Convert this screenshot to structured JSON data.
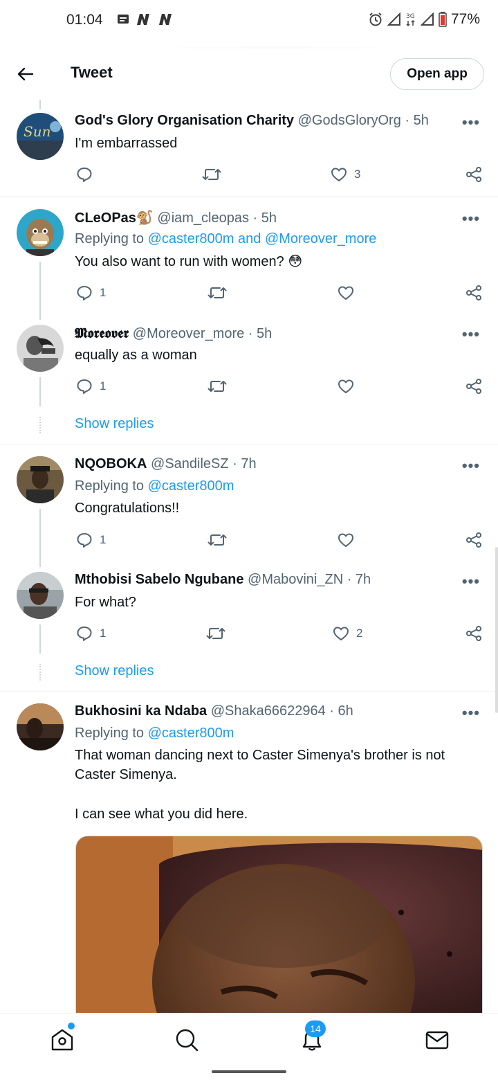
{
  "status_bar": {
    "time": "01:04",
    "left_icons": [
      "message-icon",
      "n-icon",
      "n-icon"
    ],
    "right_icons": [
      "alarm-icon",
      "signal-icon",
      "3g-icon",
      "signal-icon",
      "battery-icon"
    ],
    "network": "3G",
    "battery": "77%"
  },
  "header": {
    "title": "Tweet",
    "open_app": "Open app",
    "back_icon": "arrow-left-icon"
  },
  "tweets": [
    {
      "name": "God's Glory Organisation Charity",
      "handle": "@GodsGloryOrg",
      "time": "· 5h",
      "text": "I'm embarrassed",
      "replies": "",
      "likes": "3"
    },
    {
      "name": "CLeOPas🐒",
      "handle": "@iam_cleopas",
      "time": "· 5h",
      "replying_prefix": "Replying to ",
      "replying_to": "@caster800m and @Moreover_more",
      "text": "You also want to run with women? 😳",
      "replies": "1",
      "likes": ""
    },
    {
      "name": "𝕸𝖔𝖗𝖊𝖔𝖛𝖊𝖗",
      "handle": "@Moreover_more",
      "time": "· 5h",
      "text": "equally as a woman",
      "replies": "1",
      "likes": ""
    },
    {
      "name": "NQOBOKA",
      "handle": "@SandileSZ",
      "time": "· 7h",
      "replying_prefix": "Replying to ",
      "replying_to": "@caster800m",
      "text": "Congratulations!!",
      "replies": "1",
      "likes": ""
    },
    {
      "name": "Mthobisi Sabelo Ngubane",
      "handle": "@Mabovini_ZN",
      "time": "· 7h",
      "text": "For what?",
      "replies": "1",
      "likes": "2"
    },
    {
      "name": "Bukhosini ka Ndaba",
      "handle": "@Shaka66622964",
      "time": "· 6h",
      "replying_prefix": "Replying to ",
      "replying_to": "@caster800m",
      "text_line1": "That woman dancing next to Caster Simenya's brother is not",
      "text_line2": "Caster Simenya.",
      "text_line3": "I can see what you did here."
    }
  ],
  "show_replies": "Show replies",
  "bottom_nav": {
    "items": [
      "home-icon",
      "search-icon",
      "notifications-icon",
      "messages-icon"
    ],
    "notifications_badge": "14"
  },
  "colors": {
    "accent": "#1d9bf0",
    "text": "#0f1419",
    "secondary": "#536471",
    "border": "#cfd9de"
  }
}
